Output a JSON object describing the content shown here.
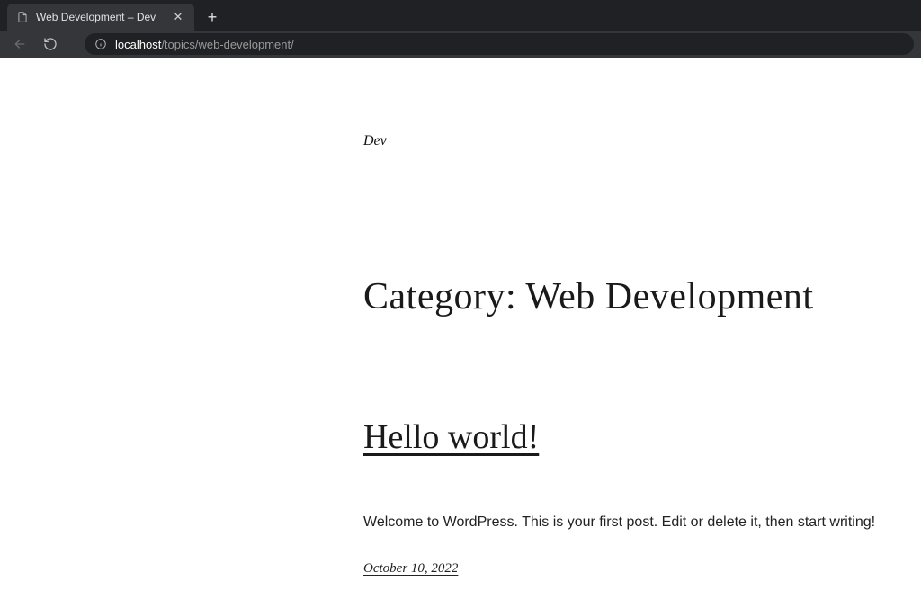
{
  "browser": {
    "tab_title": "Web Development – Dev",
    "url_host": "localhost",
    "url_path": "/topics/web-development/"
  },
  "site": {
    "title": "Dev"
  },
  "category": {
    "heading_prefix": "Category: ",
    "name": "Web Development"
  },
  "post": {
    "title": "Hello world!",
    "excerpt": "Welcome to WordPress. This is your first post. Edit or delete it, then start writing!",
    "date": "October 10, 2022"
  }
}
